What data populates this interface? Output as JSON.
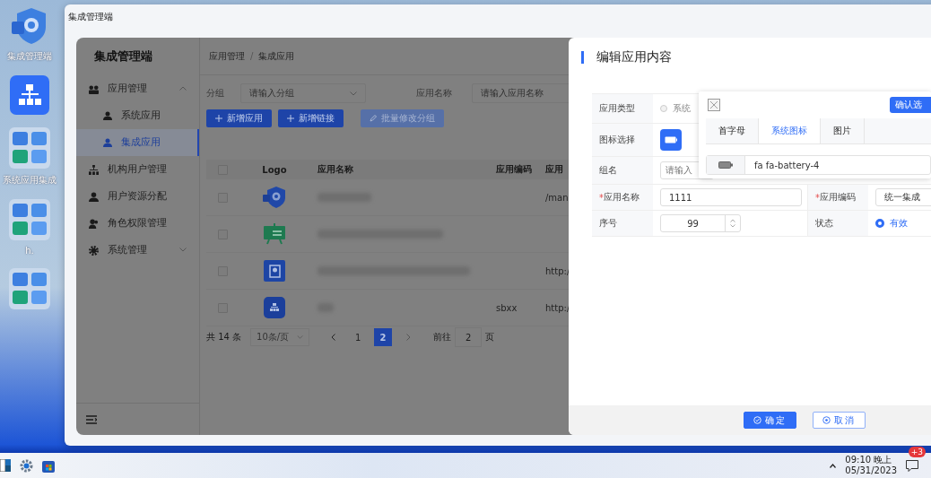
{
  "desktop": {
    "icons": [
      {
        "kind": "shield",
        "label": "集成管理端"
      },
      {
        "kind": "org"
      },
      {
        "kind": "folder",
        "label": "系统应用集成"
      },
      {
        "kind": "folder",
        "label": "h."
      },
      {
        "kind": "folder"
      }
    ]
  },
  "window": {
    "title": "集成管理端"
  },
  "app": {
    "brand": "集成管理端",
    "menu": [
      {
        "label": "应用管理",
        "kind": "apps",
        "selected": false,
        "expanded": true,
        "children": [
          {
            "label": "系统应用",
            "selected": false
          },
          {
            "label": "集成应用",
            "selected": true
          }
        ]
      },
      {
        "label": "机构用户管理",
        "kind": "org",
        "selected": false
      },
      {
        "label": "用户资源分配",
        "kind": "user",
        "selected": false
      },
      {
        "label": "角色权限管理",
        "kind": "users",
        "selected": false
      },
      {
        "label": "系统管理",
        "kind": "gear",
        "selected": false,
        "expanded": false
      }
    ],
    "breadcrumb": [
      "应用管理",
      "集成应用"
    ],
    "breadcrumb_separator": "/",
    "filters": [
      {
        "kind": "select",
        "label": "分组",
        "placeholder": "请输入分组"
      },
      {
        "kind": "input",
        "label": "应用名称",
        "placeholder": "请输入应用名称"
      }
    ],
    "actions": [
      {
        "label": "新增应用",
        "kind": "plus",
        "disabled": false
      },
      {
        "label": "新增链接",
        "kind": "plus",
        "disabled": false
      },
      {
        "label": "批量修改分组",
        "kind": "edit",
        "disabled": true
      }
    ],
    "table": {
      "all_checked": false,
      "columns": [
        "Logo",
        "应用名称",
        "应用编码",
        "应用"
      ],
      "rows": [
        {
          "kind": "shield",
          "checked": false,
          "url": "/man"
        },
        {
          "kind": "board",
          "checked": false
        },
        {
          "kind": "document",
          "checked": false,
          "url": "http:/"
        },
        {
          "kind": "org",
          "checked": false,
          "code": "sbxx",
          "url": "http:/"
        }
      ]
    },
    "pagination": {
      "total": "共 14 条",
      "page_size": "10条/页",
      "pages": [
        {
          "label": "1",
          "selected": false
        },
        {
          "label": "2",
          "selected": true
        }
      ],
      "goto_label": "前往",
      "goto_value": "2",
      "goto_suffix": "页"
    }
  },
  "drawer": {
    "title": "编辑应用内容",
    "app_type": {
      "label": "应用类型",
      "option": "系统",
      "checked": false
    },
    "icon_select": {
      "label": "图标选择"
    },
    "group": {
      "label": "组名",
      "placeholder": "请输入"
    },
    "name": {
      "label": "应用名称",
      "required_mark": "*",
      "value": "1111"
    },
    "code": {
      "label": "应用编码",
      "required_mark": "*",
      "value": "统一集成"
    },
    "order": {
      "label": "序号",
      "value": "99"
    },
    "status": {
      "label": "状态",
      "option": "有效",
      "checked": true
    },
    "picker": {
      "confirm": "确认选",
      "tabs": [
        {
          "label": "首字母",
          "selected": false
        },
        {
          "label": "系统图标",
          "selected": true
        },
        {
          "label": "图片",
          "selected": false
        }
      ],
      "value": "fa fa-battery-4"
    },
    "buttons": [
      {
        "kind": "primary",
        "label": "确定"
      },
      {
        "kind": "plain",
        "label": "取消"
      }
    ]
  },
  "taskbar": {
    "time": "09:10 晚上",
    "date": "05/31/2023",
    "badge": "+3"
  }
}
